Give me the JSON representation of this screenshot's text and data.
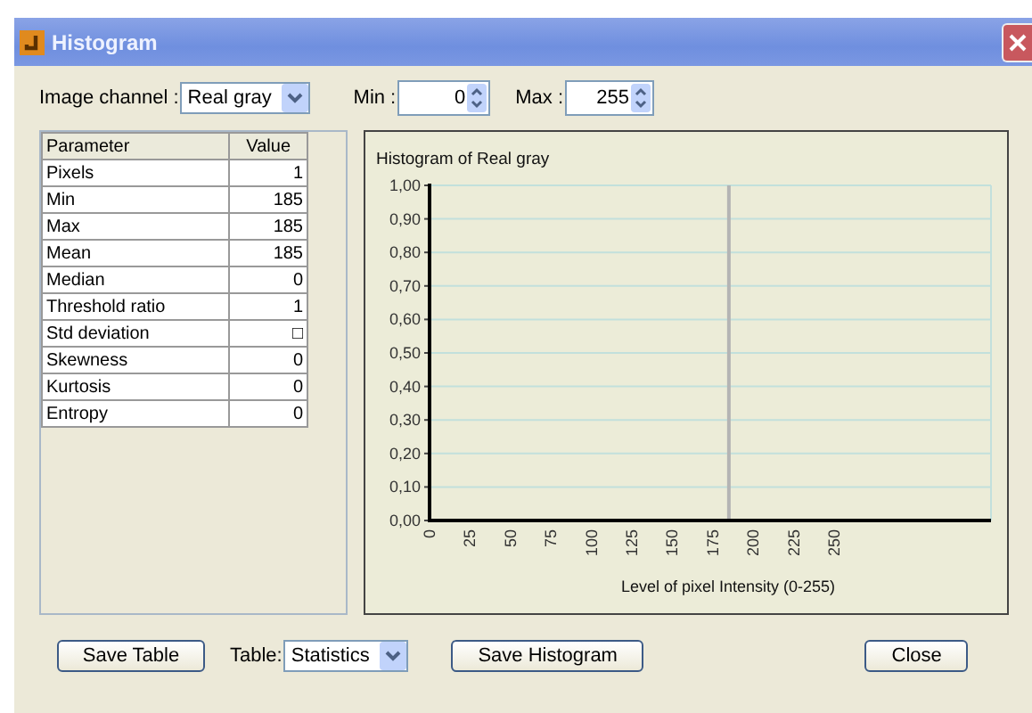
{
  "window": {
    "title": "Histogram"
  },
  "controls": {
    "channel_label": "Image channel :",
    "channel": "Real gray",
    "min_label": "Min :",
    "min": "0",
    "max_label": "Max :",
    "max": "255"
  },
  "table": {
    "columns": [
      "Parameter",
      "Value"
    ],
    "rows": [
      [
        "Pixels",
        "1"
      ],
      [
        "Min",
        "185"
      ],
      [
        "Max",
        "185"
      ],
      [
        "Mean",
        "185"
      ],
      [
        "Median",
        "0"
      ],
      [
        "Threshold ratio",
        "1"
      ],
      [
        "Std deviation",
        "□"
      ],
      [
        "Skewness",
        "0"
      ],
      [
        "Kurtosis",
        "0"
      ],
      [
        "Entropy",
        "0"
      ]
    ]
  },
  "histogram": {
    "chart_data": {
      "type": "bar",
      "title": "Histogram of Real gray",
      "xlabel": "Level of pixel Intensity (0-255)",
      "x": [
        185
      ],
      "series": [
        {
          "color": "#b4b4b4",
          "values": [
            1
          ]
        }
      ],
      "grid": true,
      "xlim": [
        0,
        347
      ],
      "ylim": [
        0,
        1
      ],
      "xticks": [
        0,
        25,
        50,
        75,
        100,
        125,
        150,
        175,
        200,
        225,
        250
      ],
      "yticks": [
        {
          "value": 0,
          "label": "0,00"
        },
        {
          "value": 0.1,
          "label": "0,10"
        },
        {
          "value": 0.2,
          "label": "0,20"
        },
        {
          "value": 0.3,
          "label": "0,30"
        },
        {
          "value": 0.4,
          "label": "0,40"
        },
        {
          "value": 0.5,
          "label": "0,50"
        },
        {
          "value": 0.6,
          "label": "0,60"
        },
        {
          "value": 0.7,
          "label": "0,70"
        },
        {
          "value": 0.8,
          "label": "0,80"
        },
        {
          "value": 0.9,
          "label": "0,90"
        },
        {
          "value": 1,
          "label": "1,00"
        }
      ]
    }
  },
  "footer": {
    "save_table": "Save Table",
    "table_label": "Table:",
    "table_select": "Statistics",
    "save_histogram": "Save Histogram",
    "close": "Close"
  }
}
